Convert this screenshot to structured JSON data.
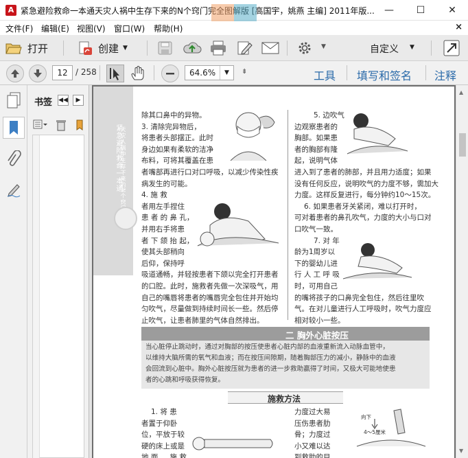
{
  "window": {
    "title": "紧急避险救命一本通天灾人祸中生存下来的N个窍门完全图解版 [高国宇，姚燕 主编] 2011年版...",
    "minimize": "—",
    "maximize": "☐",
    "close": "✕"
  },
  "menu": {
    "items": [
      "文件(F)",
      "编辑(E)",
      "视图(V)",
      "窗口(W)",
      "帮助(H)"
    ],
    "close_glyph": "×"
  },
  "toolbar": {
    "open_label": "打开",
    "create_label": "创建",
    "custom_label": "自定义",
    "icons": [
      "folder-open-icon",
      "create-pdf-icon",
      "save-icon",
      "upload-icon",
      "print-icon",
      "edit-icon",
      "email-icon",
      "gear-icon",
      "expand-icon"
    ]
  },
  "nav": {
    "current_page": "12",
    "total_pages": "/ 258",
    "zoom": "64.6%",
    "tools_label": "工具",
    "sign_label": "填写和签名",
    "comment_label": "注释"
  },
  "bookmarks": {
    "title": "书签"
  },
  "page": {
    "margin_title": "紧急避险救命一本通",
    "margin_subtitle": "天灾人祸中生存下来的N个窍门",
    "left_col": [
      "除其口鼻中的异物。",
      "3. 清除完异物后，",
      "将患者头部摆正。此时",
      "身边如果有柔软的洁净",
      "布料，可将其覆盖在患",
      "者嘴部再进行口对口呼吸，以减少传染性疾",
      "病发生的可能。",
      "4. 施 救",
      "者用左手捏住",
      "患 者 的 鼻 孔，",
      "并用右手将患",
      "者 下 颌 抬 起，",
      "使其头部稍向",
      "后仰，保持呼",
      "吸道通畅，并轻按患者下颌以完全打开患者",
      "的口腔。此时，施救者先做一次深吸气，用",
      "自己的嘴唇将患者的嘴唇完全包住并开始均",
      "匀吹气，尽量做到持续时间长一些。然后停",
      "止吹气，让患者肺里的气体自然排出。"
    ],
    "right_col": [
      "5. 边吹气",
      "边观察患者的",
      "胸部。如果患",
      "者的胸部有隆",
      "起，说明气体",
      "进入到了患者的肺部，并且用力适度；如果",
      "没有任何反应，说明吹气的力度不够，需加大",
      "力度。这样反复进行，每分钟约10～15次。",
      "6. 如果患者牙关紧闭，难以打开时，",
      "可对着患者的鼻孔吹气，力度的大小与口对",
      "口吹气一致。",
      "7. 对 年",
      "龄为1周岁以",
      "下的婴幼儿进",
      "行 人 工 呼 吸",
      "时，可用自己",
      "的嘴将孩子的口鼻完全包住，然后往里吹",
      "气。在对儿童进行人工呼吸时，吹气力度应",
      "相对较小一些。"
    ],
    "section_title": "二  胸外心脏按压",
    "intro": [
      "当心脏停止跳动时，通过对胸部的按压使患者心脏内部的血液重新流入动脉血管中，",
      "以维持大脑所需的氧气和血液；而在按压间隙期，随着胸部压力的减小，静脉中的血液",
      "会回流到心脏中。胸外心脏按压就为患者的进一步救助赢得了时间，又极大可能地使患",
      "者的心跳和呼吸获得恢复。"
    ],
    "method_title": "施救方法",
    "bottom_left": [
      "1. 将 患",
      "者置于仰卧",
      "位，平放于较",
      "硬的床上或是",
      "地 面 。 施 救"
    ],
    "bottom_right": [
      "力度过大易",
      "压伤患者肋",
      "骨；力度过",
      "小又难以达",
      "到救助的目"
    ],
    "figure_labels": [
      "向下",
      "4～5厘米"
    ]
  }
}
